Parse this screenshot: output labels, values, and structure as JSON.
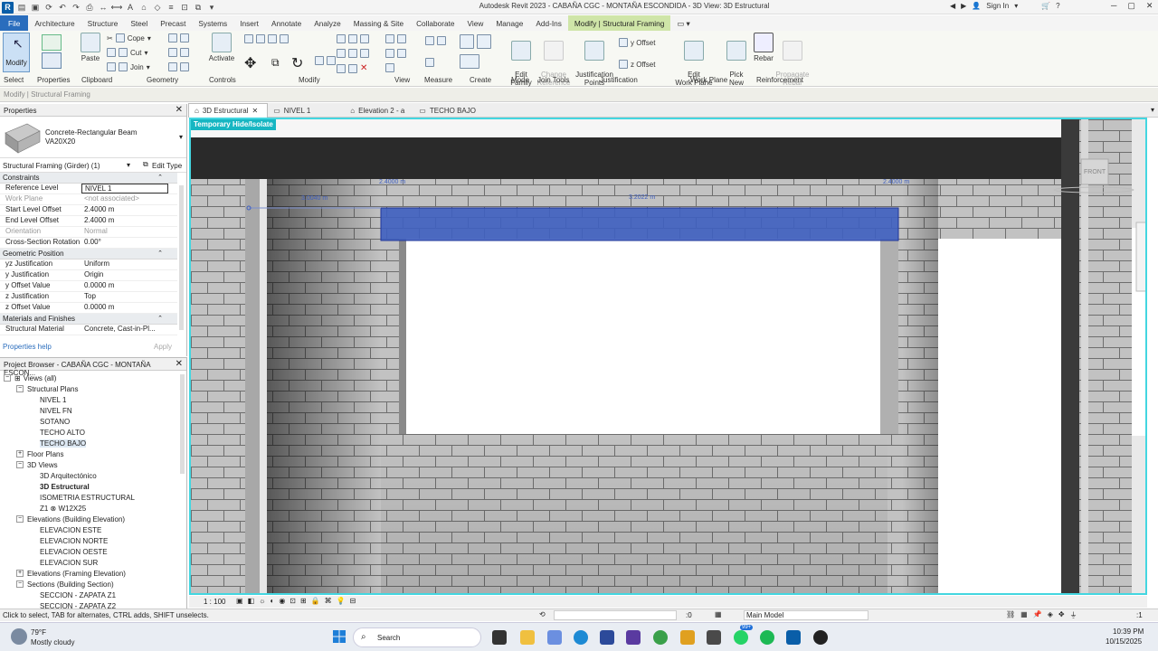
{
  "app": {
    "title": "Autodesk Revit 2023 - CABAÑA CGC - MONTAÑA ESCONDIDA - 3D View: 3D Estructural",
    "sign_in": "Sign In",
    "brand_color": "#0a5ea8",
    "context_color": "#cfe5a8"
  },
  "menu": {
    "file": "File",
    "tabs": [
      "Architecture",
      "Structure",
      "Steel",
      "Precast",
      "Systems",
      "Insert",
      "Annotate",
      "Analyze",
      "Massing & Site",
      "Collaborate",
      "View",
      "Manage",
      "Add-Ins",
      "Modify | Structural Framing"
    ]
  },
  "ribbon": {
    "modify": "Modify",
    "paste": "Paste",
    "cope": "Cope",
    "cut": "Cut",
    "join": "Join",
    "activate": "Activate",
    "edit_family": "Edit\nFamily",
    "change_reference": "Change\nReference",
    "justification_points": "Justification\nPoints",
    "y_offset": "y Offset",
    "z_offset": "z Offset",
    "edit_work_plane": "Edit\nWork Plane",
    "pick_new": "Pick\nNew",
    "rebar": "Rebar",
    "propagate_rebar": "Propagate\nRebar",
    "groups": [
      "Select",
      "Properties",
      "Clipboard",
      "Geometry",
      "Controls",
      "Modify",
      "View",
      "Measure",
      "Create",
      "Mode",
      "Join Tools",
      "Justification",
      "Work Plane",
      "Reinforcement"
    ]
  },
  "select_bar": {
    "label": "Modify | Structural Framing"
  },
  "properties": {
    "title": "Properties",
    "type_name": "Concrete-Rectangular Beam",
    "type_sub": "VA20X20",
    "filter": "Structural Framing (Girder) (1)",
    "edit_type": "Edit Type",
    "sections": [
      {
        "name": "Constraints",
        "rows": [
          {
            "k": "Reference Level",
            "v": "NIVEL 1",
            "sel": true
          },
          {
            "k": "Work Plane",
            "v": "<not associated>",
            "dis": true
          },
          {
            "k": "Start Level Offset",
            "v": "2.4000 m"
          },
          {
            "k": "End Level Offset",
            "v": "2.4000 m"
          },
          {
            "k": "Orientation",
            "v": "Normal",
            "dis": true
          },
          {
            "k": "Cross-Section Rotation",
            "v": "0.00°"
          }
        ]
      },
      {
        "name": "Geometric Position",
        "rows": [
          {
            "k": "yz Justification",
            "v": "Uniform"
          },
          {
            "k": "y Justification",
            "v": "Origin"
          },
          {
            "k": "y Offset Value",
            "v": "0.0000 m"
          },
          {
            "k": "z Justification",
            "v": "Top"
          },
          {
            "k": "z Offset Value",
            "v": "0.0000 m"
          }
        ]
      },
      {
        "name": "Materials and Finishes",
        "rows": [
          {
            "k": "Structural Material",
            "v": "Concrete, Cast-in-Pl..."
          }
        ]
      }
    ],
    "help": "Properties help",
    "apply": "Apply"
  },
  "browser": {
    "title": "Project Browser - CABAÑA CGC - MONTAÑA ESCON...",
    "tree": [
      {
        "label": "Views (all)",
        "lvl": 0,
        "exp": "−",
        "icon": true
      },
      {
        "label": "Structural Plans",
        "lvl": 1,
        "exp": "−"
      },
      {
        "label": "NIVEL 1",
        "lvl": 2
      },
      {
        "label": "NIVEL FN",
        "lvl": 2
      },
      {
        "label": "SOTANO",
        "lvl": 2
      },
      {
        "label": "TECHO ALTO",
        "lvl": 2
      },
      {
        "label": "TECHO BAJO",
        "lvl": 2,
        "hl": true
      },
      {
        "label": "Floor Plans",
        "lvl": 1,
        "exp": "+"
      },
      {
        "label": "3D Views",
        "lvl": 1,
        "exp": "−"
      },
      {
        "label": "3D Arquitectónico",
        "lvl": 2
      },
      {
        "label": "3D Estructural",
        "lvl": 2,
        "bold": true
      },
      {
        "label": "ISOMETRIA ESTRUCTURAL",
        "lvl": 2
      },
      {
        "label": "Z1 ⊗ W12X25",
        "lvl": 2
      },
      {
        "label": "Elevations (Building Elevation)",
        "lvl": 1,
        "exp": "−"
      },
      {
        "label": "ELEVACION ESTE",
        "lvl": 2
      },
      {
        "label": "ELEVACION NORTE",
        "lvl": 2
      },
      {
        "label": "ELEVACION OESTE",
        "lvl": 2
      },
      {
        "label": "ELEVACION SUR",
        "lvl": 2
      },
      {
        "label": "Elevations (Framing Elevation)",
        "lvl": 1,
        "exp": "+"
      },
      {
        "label": "Sections (Building Section)",
        "lvl": 1,
        "exp": "−"
      },
      {
        "label": "SECCION - ZAPATA Z1",
        "lvl": 2
      },
      {
        "label": "SECCION - ZAPATA Z2",
        "lvl": 2
      }
    ]
  },
  "view_tabs": [
    {
      "label": "3D Estructural",
      "active": true,
      "closable": true
    },
    {
      "label": "NIVEL 1"
    },
    {
      "label": "Elevation 2 - a"
    },
    {
      "label": "TECHO BAJO"
    }
  ],
  "viewport": {
    "temp_hide": "Temporary Hide/Isolate",
    "viewcube": "FRONT",
    "dims": [
      "2.4000 m",
      "3.0040 m",
      "3.2022 m",
      "2.4000 m"
    ],
    "highlight_color": "#43d6e0",
    "beam_color": "#3e5fc0"
  },
  "view_control": {
    "scale": "1 : 100"
  },
  "status": {
    "hint": "Click to select, TAB for alternates, CTRL adds, SHIFT unselects.",
    "sel_count": ":0",
    "model": "Main Model",
    "filter": ":1"
  },
  "taskbar": {
    "temp": "79°F",
    "weather": "Mostly cloudy",
    "search": "Search",
    "time": "10:39 PM",
    "date": "10/15/2025",
    "badge": "99+"
  }
}
